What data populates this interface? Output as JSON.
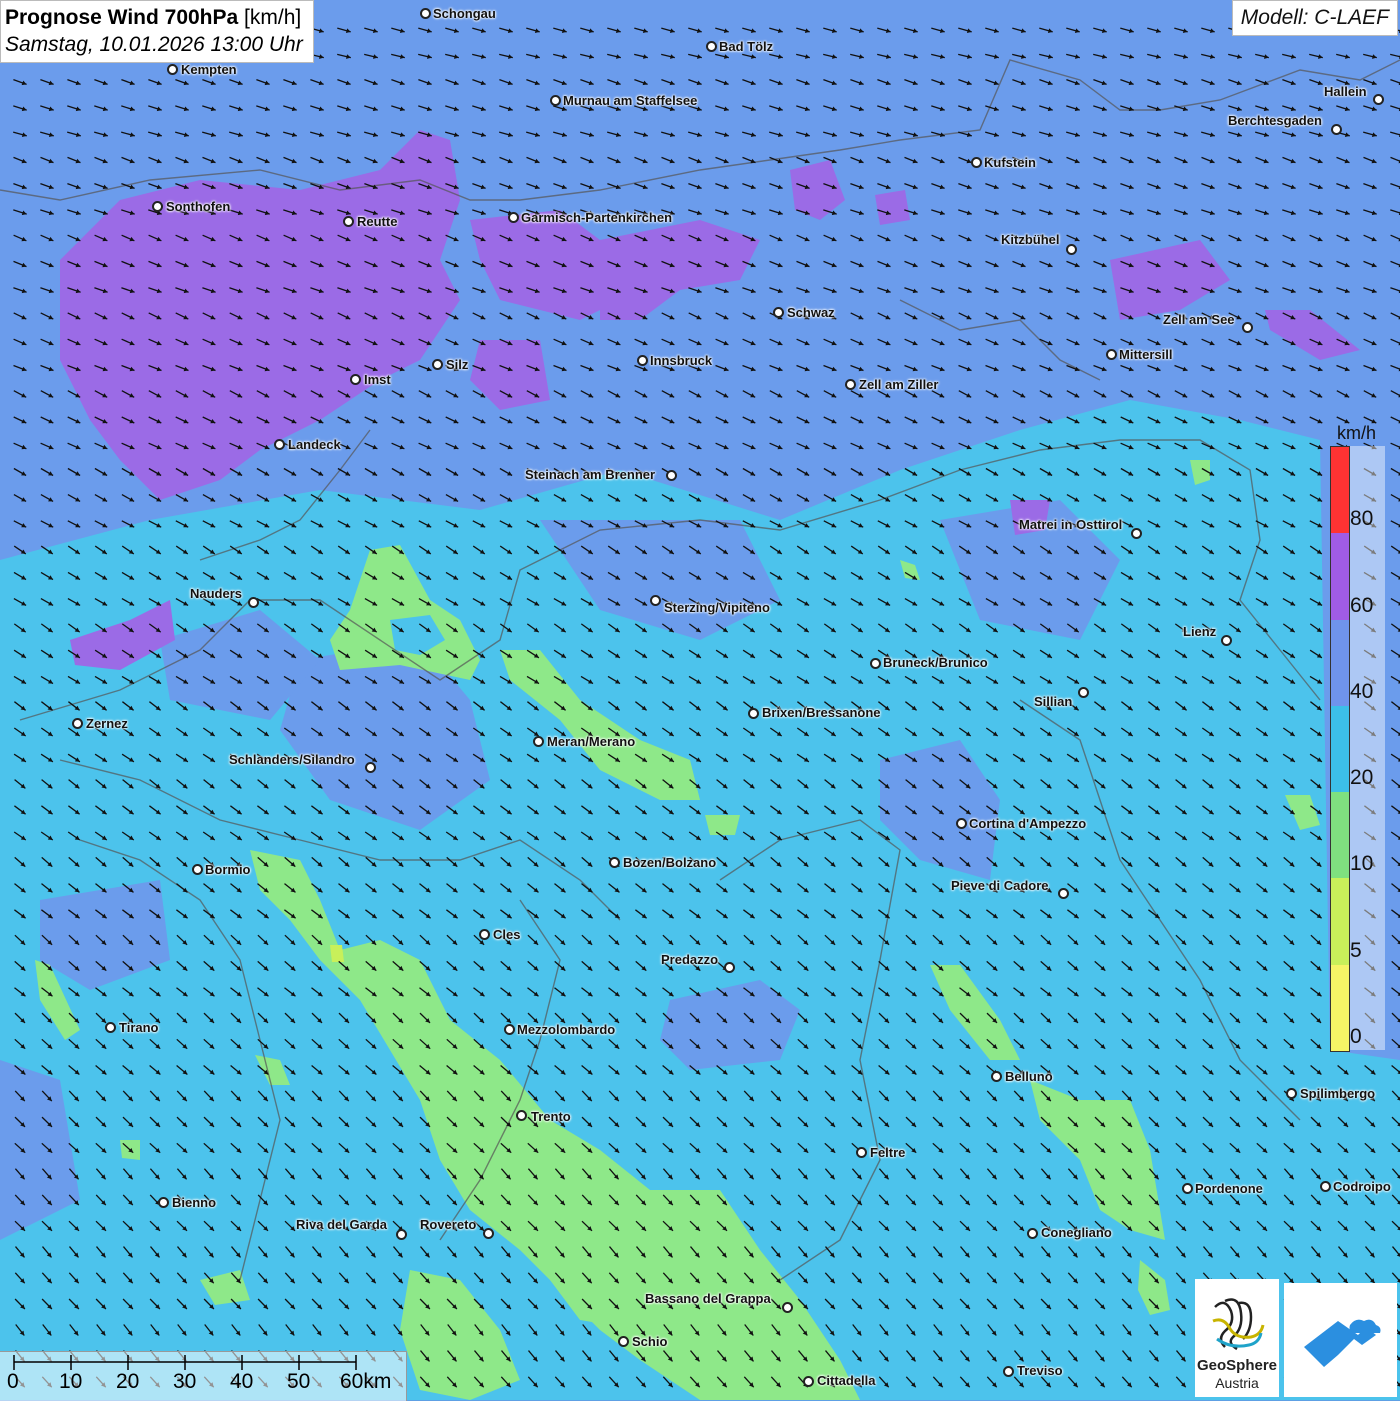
{
  "header": {
    "title": "Prognose Wind 700hPa",
    "unit": "[km/h]",
    "datetime": "Samstag, 10.01.2026 13:00 Uhr",
    "model": "Modell: C-LAEF"
  },
  "cities": [
    {
      "name": "Schongau"
    },
    {
      "name": "Bad Tölz"
    },
    {
      "name": "Kempten"
    },
    {
      "name": "Murnau am Staffelsee"
    },
    {
      "name": "Hallein"
    },
    {
      "name": "Berchtesgaden"
    },
    {
      "name": "Kufstein"
    },
    {
      "name": "Sonthofen"
    },
    {
      "name": "Reutte"
    },
    {
      "name": "Garmisch-Partenkirchen"
    },
    {
      "name": "Kitzbühel"
    },
    {
      "name": "Schwaz"
    },
    {
      "name": "Zell am See"
    },
    {
      "name": "Mittersill"
    },
    {
      "name": "Innsbruck"
    },
    {
      "name": "Silz"
    },
    {
      "name": "Imst"
    },
    {
      "name": "Zell am Ziller"
    },
    {
      "name": "Landeck"
    },
    {
      "name": "Steinach am Brenner"
    },
    {
      "name": "Matrei in Osttirol"
    },
    {
      "name": "Nauders"
    },
    {
      "name": "Sterzing/Vipiteno"
    },
    {
      "name": "Lienz"
    },
    {
      "name": "Bruneck/Brunico"
    },
    {
      "name": "Sillian"
    },
    {
      "name": "Zernez"
    },
    {
      "name": "Brixen/Bressanone"
    },
    {
      "name": "Meran/Merano"
    },
    {
      "name": "Schlanders/Silandro"
    },
    {
      "name": "Cortina d'Ampezzo"
    },
    {
      "name": "Bozen/Bolzano"
    },
    {
      "name": "Bormio"
    },
    {
      "name": "Pieve di Cadore"
    },
    {
      "name": "Cles"
    },
    {
      "name": "Predazzo"
    },
    {
      "name": "Tirano"
    },
    {
      "name": "Mezzolombardo"
    },
    {
      "name": "Belluno"
    },
    {
      "name": "Spilimbergo"
    },
    {
      "name": "Trento"
    },
    {
      "name": "Feltre"
    },
    {
      "name": "Pordenone"
    },
    {
      "name": "Codroipo"
    },
    {
      "name": "Bienno"
    },
    {
      "name": "Riva del Garda"
    },
    {
      "name": "Rovereto"
    },
    {
      "name": "Conegliano"
    },
    {
      "name": "Bassano del Grappa"
    },
    {
      "name": "Schio"
    },
    {
      "name": "Treviso"
    },
    {
      "name": "Cittadella"
    }
  ],
  "legend": {
    "unit": "km/h",
    "labels": [
      "80",
      "60",
      "40",
      "20",
      "10",
      "5",
      "0"
    ],
    "colors": [
      "#ff3333",
      "#a05ce6",
      "#6f94ec",
      "#3cbfe8",
      "#7fe07f",
      "#c8f05a",
      "#f6f466"
    ]
  },
  "colors": {
    "purple": "#9b6be6",
    "blue": "#6b9cec",
    "cyan": "#4cc3ec",
    "green": "#8ee889",
    "arrow": "#111111"
  },
  "scale": {
    "labels": [
      "0",
      "10",
      "20",
      "30",
      "40",
      "50",
      "60km"
    ]
  },
  "logos": {
    "geosphere_line1": "GeoSphere",
    "geosphere_line2": "Austria"
  }
}
